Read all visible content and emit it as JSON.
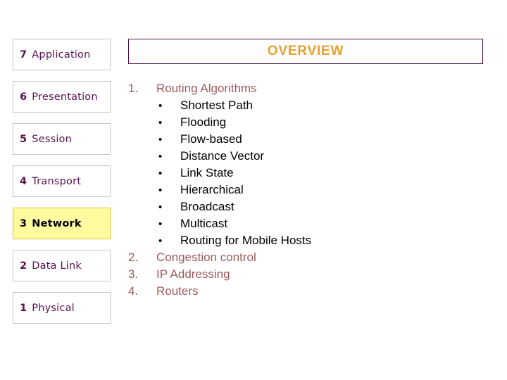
{
  "slide": {
    "background_color": "#ffffff"
  },
  "osi_stack": {
    "name": "osi-layer-stack",
    "highlight_fill": "#fffba0",
    "highlight_border": "#e0c22a",
    "text_color": "#5a1050",
    "layers": [
      {
        "number": "7",
        "label": "Application",
        "highlighted": false
      },
      {
        "number": "6",
        "label": "Presentation",
        "highlighted": false
      },
      {
        "number": "5",
        "label": "Session",
        "highlighted": false
      },
      {
        "number": "4",
        "label": "Transport",
        "highlighted": false
      },
      {
        "number": "3",
        "label": "Network",
        "highlighted": true
      },
      {
        "number": "2",
        "label": "Data Link",
        "highlighted": false
      },
      {
        "number": "1",
        "label": "Physical",
        "highlighted": false
      }
    ]
  },
  "title_banner": {
    "text": "OVERVIEW",
    "text_color": "#e8a030",
    "border_color": "#4a1040"
  },
  "outline": {
    "number_color": "#a05a5a",
    "bullet_color": "#000000",
    "items": [
      {
        "type": "numbered",
        "marker": "1.",
        "label": "Routing Algorithms"
      },
      {
        "type": "bullet",
        "marker": "•",
        "label": "Shortest Path"
      },
      {
        "type": "bullet",
        "marker": "•",
        "label": "Flooding"
      },
      {
        "type": "bullet",
        "marker": "•",
        "label": "Flow-based"
      },
      {
        "type": "bullet",
        "marker": "•",
        "label": "Distance Vector"
      },
      {
        "type": "bullet",
        "marker": "•",
        "label": "Link State"
      },
      {
        "type": "bullet",
        "marker": "•",
        "label": "Hierarchical"
      },
      {
        "type": "bullet",
        "marker": "•",
        "label": "Broadcast"
      },
      {
        "type": "bullet",
        "marker": "•",
        "label": "Multicast"
      },
      {
        "type": "bullet",
        "marker": "•",
        "label": "Routing for Mobile Hosts"
      },
      {
        "type": "numbered",
        "marker": "2.",
        "label": "Congestion control"
      },
      {
        "type": "numbered",
        "marker": "3.",
        "label": "IP Addressing"
      },
      {
        "type": "numbered",
        "marker": "4.",
        "label": "Routers"
      }
    ]
  }
}
